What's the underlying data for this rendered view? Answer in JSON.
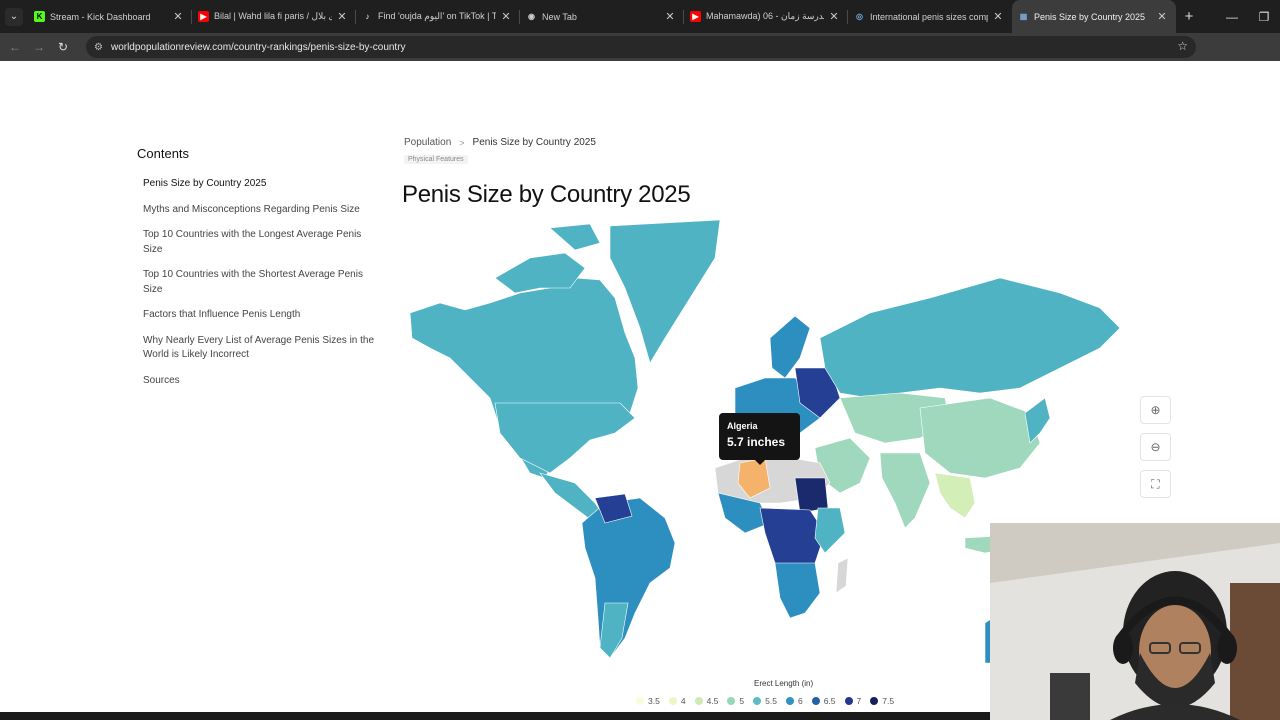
{
  "browser": {
    "tabs": [
      {
        "title": "Stream - Kick Dashboard",
        "favicon_color": "#53fc18",
        "favicon_char": "K"
      },
      {
        "title": "Bilal | Wahd lila fi paris / ری بلال",
        "favicon_color": "#ff0000",
        "favicon_char": "▶"
      },
      {
        "title": "Find 'oujda اليوم' on TikTok | Ti",
        "favicon_color": "#ffffff",
        "favicon_char": "♪"
      },
      {
        "title": "New Tab",
        "favicon_color": "#cccccc",
        "favicon_char": "◉"
      },
      {
        "title": "Mahamawda) 06 - مدرسة زمان",
        "favicon_color": "#ff0000",
        "favicon_char": "▶"
      },
      {
        "title": "International penis sizes compa",
        "favicon_color": "#6fa8dc",
        "favicon_char": "◎"
      },
      {
        "title": "Penis Size by Country 2025",
        "favicon_color": "#7aa7d6",
        "favicon_char": "▦"
      }
    ],
    "active_tab_index": 6,
    "url": "worldpopulationreview.com/country-rankings/penis-size-by-country"
  },
  "toc": {
    "heading": "Contents",
    "items": [
      "Penis Size by Country 2025",
      "Myths and Misconceptions Regarding Penis Size",
      "Top 10 Countries with the Longest Average Penis Size",
      "Top 10 Countries with the Shortest Average Penis Size",
      "Factors that Influence Penis Length",
      "Why Nearly Every List of Average Penis Sizes in the World is Likely Incorrect",
      "Sources"
    ]
  },
  "breadcrumb": {
    "parent": "Population",
    "separator": ">",
    "current": "Penis Size by Country 2025",
    "tag": "Physical Features"
  },
  "page_title": "Penis Size by Country 2025",
  "tooltip": {
    "country": "Algeria",
    "value": "5.7 inches"
  },
  "legend": {
    "title": "Erect Length (in)",
    "items": [
      {
        "label": "3.5",
        "color": "#fdfbd8"
      },
      {
        "label": "4",
        "color": "#eef7c4"
      },
      {
        "label": "4.5",
        "color": "#cdebb6"
      },
      {
        "label": "5",
        "color": "#98d6b8"
      },
      {
        "label": "5.5",
        "color": "#5ebcc1"
      },
      {
        "label": "6",
        "color": "#2e93c2"
      },
      {
        "label": "6.5",
        "color": "#2561a8"
      },
      {
        "label": "7",
        "color": "#23398f"
      },
      {
        "label": "7.5",
        "color": "#13215a"
      }
    ]
  },
  "map_colors": {
    "base": "#4fb3c4",
    "light": "#9fd8bc",
    "pale": "#d4eeb8",
    "mid": "#2c8fc0",
    "dark": "#253f95",
    "darkest": "#1a2a6c",
    "nodata": "#d7d7d7",
    "highlight": "#f4b26b"
  }
}
